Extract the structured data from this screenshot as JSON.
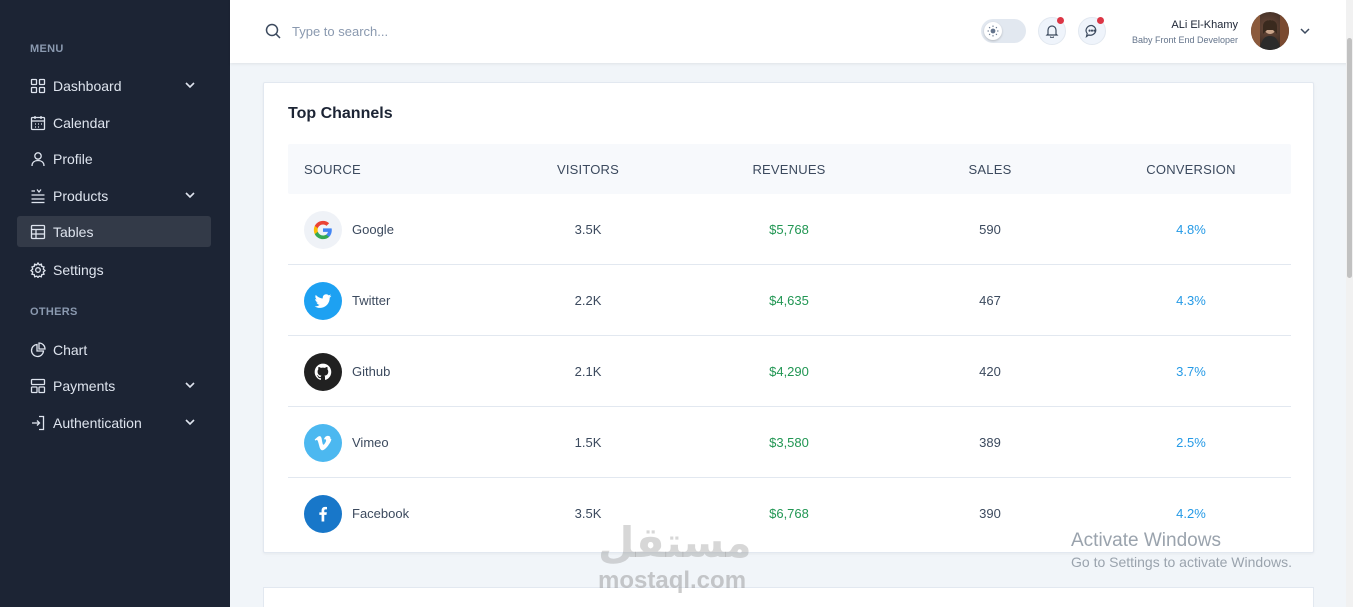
{
  "sidebar": {
    "menu_heading": "MENU",
    "others_heading": "OTHERS",
    "items": [
      {
        "label": "Dashboard",
        "icon": "grid-icon",
        "has_chevron": true,
        "active": false
      },
      {
        "label": "Calendar",
        "icon": "calendar-icon",
        "has_chevron": false,
        "active": false
      },
      {
        "label": "Profile",
        "icon": "user-icon",
        "has_chevron": false,
        "active": false
      },
      {
        "label": "Products",
        "icon": "list-icon",
        "has_chevron": true,
        "active": false
      },
      {
        "label": "Tables",
        "icon": "table-icon",
        "has_chevron": false,
        "active": true
      },
      {
        "label": "Settings",
        "icon": "gear-icon",
        "has_chevron": false,
        "active": false
      }
    ],
    "others": [
      {
        "label": "Chart",
        "icon": "pie-chart-icon",
        "has_chevron": false
      },
      {
        "label": "Payments",
        "icon": "layout-icon",
        "has_chevron": true
      },
      {
        "label": "Authentication",
        "icon": "login-icon",
        "has_chevron": true
      }
    ]
  },
  "header": {
    "search_placeholder": "Type to search...",
    "user_name": "ALi El-Khamy",
    "user_role": "Baby Front End Developer"
  },
  "table": {
    "title": "Top Channels",
    "columns": [
      "SOURCE",
      "VISITORS",
      "REVENUES",
      "SALES",
      "CONVERSION"
    ],
    "rows": [
      {
        "source": "Google",
        "visitors": "3.5K",
        "revenues": "$5,768",
        "sales": "590",
        "conversion": "4.8%"
      },
      {
        "source": "Twitter",
        "visitors": "2.2K",
        "revenues": "$4,635",
        "sales": "467",
        "conversion": "4.3%"
      },
      {
        "source": "Github",
        "visitors": "2.1K",
        "revenues": "$4,290",
        "sales": "420",
        "conversion": "3.7%"
      },
      {
        "source": "Vimeo",
        "visitors": "1.5K",
        "revenues": "$3,580",
        "sales": "389",
        "conversion": "2.5%"
      },
      {
        "source": "Facebook",
        "visitors": "3.5K",
        "revenues": "$6,768",
        "sales": "390",
        "conversion": "4.2%"
      }
    ]
  },
  "overlay": {
    "activate_title": "Activate Windows",
    "activate_sub": "Go to Settings to activate Windows.",
    "logo_arabic": "مستقل",
    "logo_text": "mostaql.com"
  },
  "colors": {
    "sidebar_bg": "#1c2434",
    "revenue_green": "#219653",
    "conversion_blue": "#259ae6",
    "notification_red": "#dc3545"
  }
}
